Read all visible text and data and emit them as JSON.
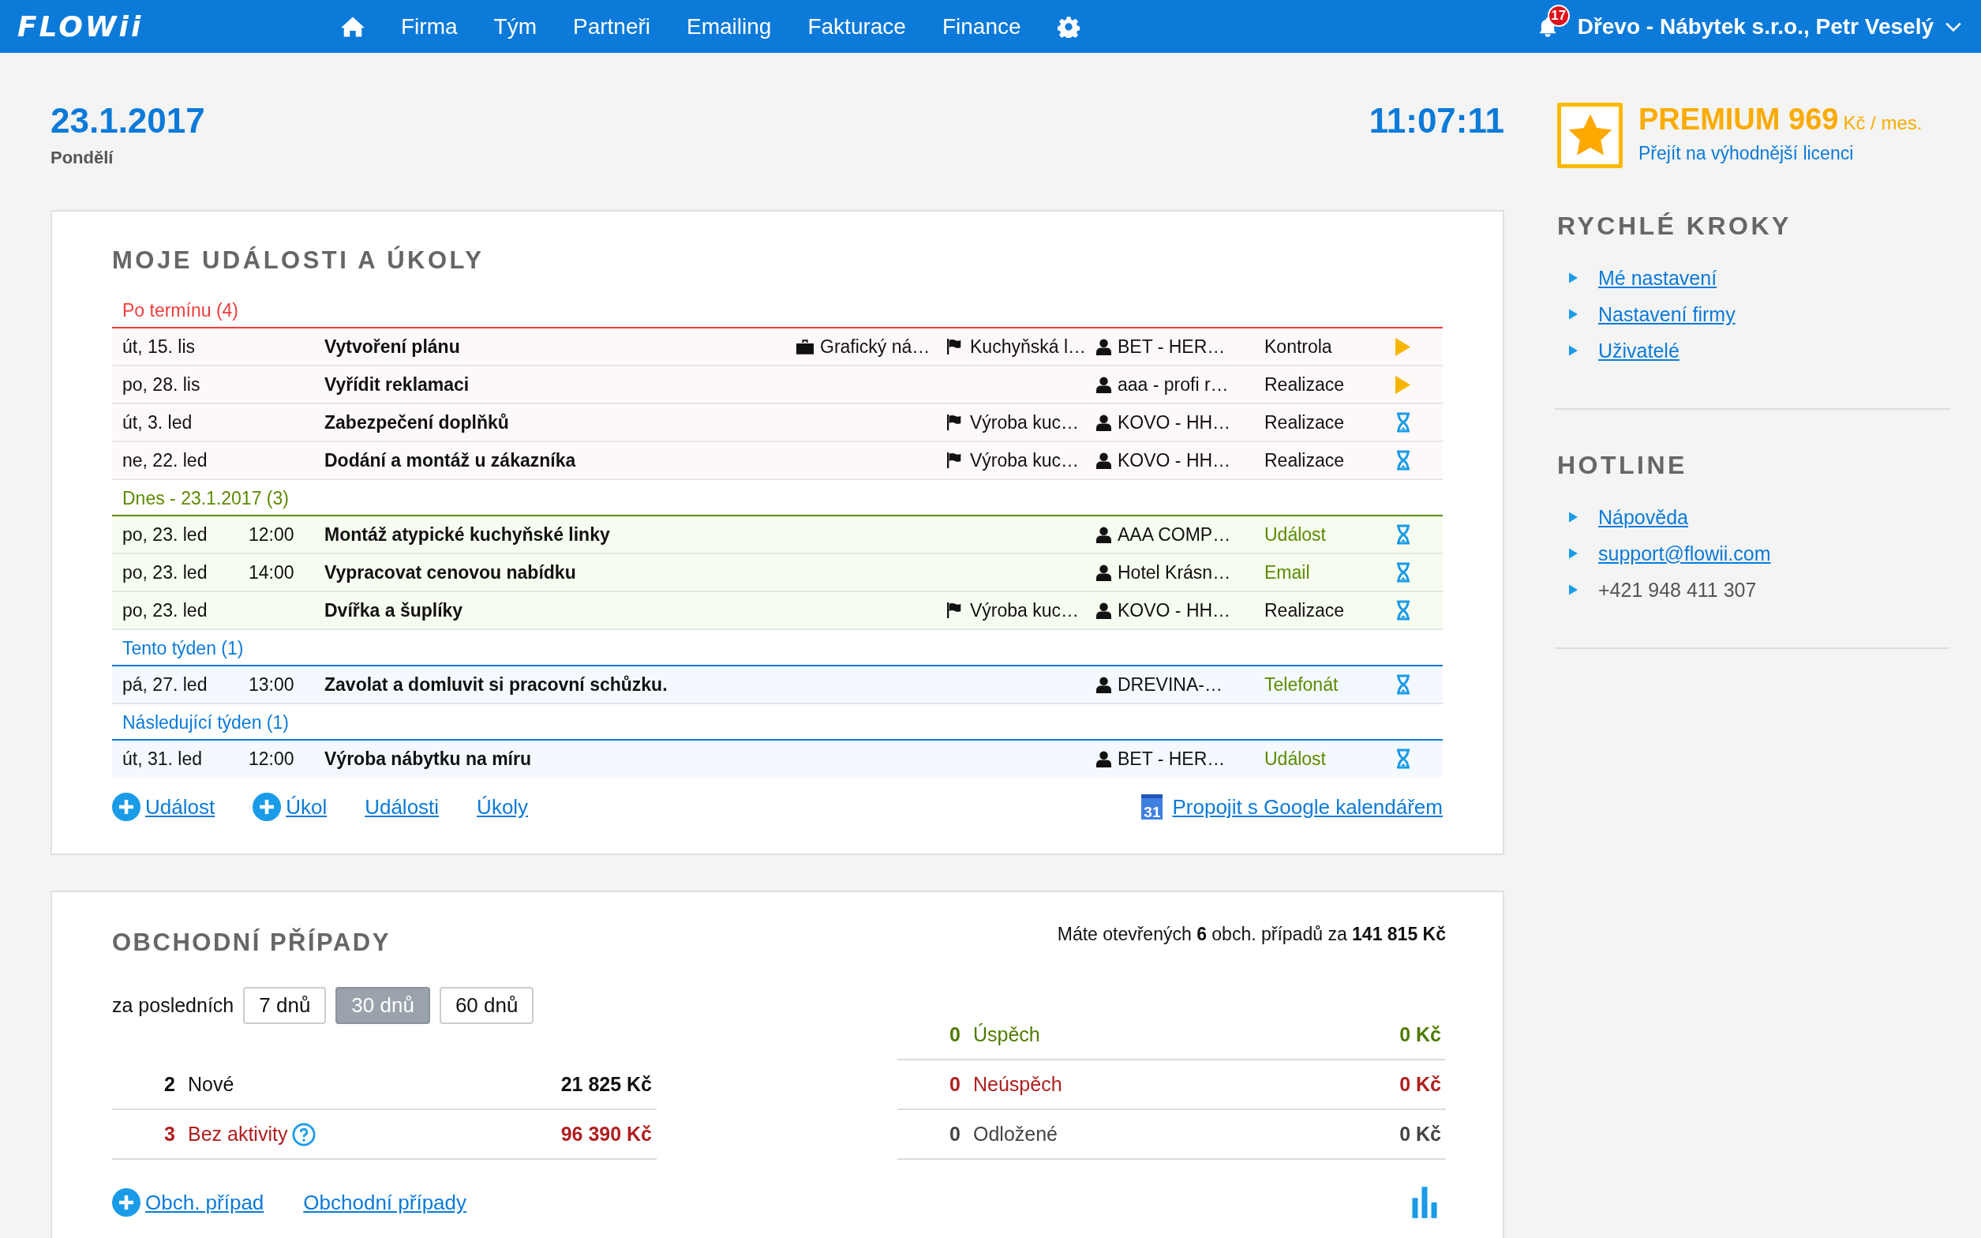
{
  "nav": {
    "logo": "FLOWii",
    "items": [
      "Firma",
      "Tým",
      "Partneři",
      "Emailing",
      "Fakturace",
      "Finance"
    ],
    "notifications": "17",
    "account": "Dřevo - Nábytek s.r.o., Petr Veselý"
  },
  "date": "23.1.2017",
  "weekday": "Pondělí",
  "time": "11:07:11",
  "events": {
    "title": "MOJE UDÁLOSTI A ÚKOLY",
    "groups": [
      {
        "label": "Po termínu (4)",
        "kind": "overdue",
        "rows": [
          {
            "date": "út, 15. lis",
            "title": "Vytvoření plánu",
            "project": "Grafický ná…",
            "deal": "Kuchyňská l…",
            "contact": "BET - HER…",
            "type": "Kontrola",
            "activity": false,
            "started": true
          },
          {
            "date": "po, 28. lis",
            "title": "Vyřídit reklamaci",
            "contact": "aaa - profi r…",
            "type": "Realizace",
            "activity": false,
            "started": true
          },
          {
            "date": "út, 3. led",
            "title": "Zabezpečení doplňků",
            "deal": "Výroba kuc…",
            "contact": "KOVO - HH…",
            "type": "Realizace",
            "activity": false,
            "started": false
          },
          {
            "date": "ne, 22. led",
            "title": "Dodání a montáž u zákazníka",
            "deal": "Výroba kuc…",
            "contact": "KOVO - HH…",
            "type": "Realizace",
            "activity": false,
            "started": false
          }
        ]
      },
      {
        "label": "Dnes - 23.1.2017 (3)",
        "kind": "today",
        "rows": [
          {
            "date": "po, 23. led",
            "time": "12:00",
            "title": "Montáž atypické kuchyňské linky",
            "contact": "AAA COMP…",
            "type": "Událost",
            "activity": true,
            "started": false
          },
          {
            "date": "po, 23. led",
            "time": "14:00",
            "title": "Vypracovat cenovou nabídku",
            "contact": "Hotel Krásn…",
            "type": "Email",
            "activity": true,
            "started": false
          },
          {
            "date": "po, 23. led",
            "title": "Dvířka a šuplíky",
            "deal": "Výroba kuc…",
            "contact": "KOVO - HH…",
            "type": "Realizace",
            "activity": false,
            "started": false
          }
        ]
      },
      {
        "label": "Tento týden (1)",
        "kind": "week",
        "rows": [
          {
            "date": "pá, 27. led",
            "time": "13:00",
            "title": "Zavolat a domluvit si pracovní schůzku.",
            "contact": "DREVINA-…",
            "type": "Telefonát",
            "activity": true,
            "started": false
          }
        ]
      },
      {
        "label": "Následující týden (1)",
        "kind": "week",
        "rows": [
          {
            "date": "út, 31. led",
            "time": "12:00",
            "title": "Výroba nábytku na míru",
            "contact": "BET - HER…",
            "type": "Událost",
            "activity": true,
            "started": false
          }
        ]
      }
    ],
    "links": [
      {
        "text": "Událost",
        "add": true
      },
      {
        "text": "Úkol",
        "add": true
      },
      {
        "text": "Události",
        "add": false
      },
      {
        "text": "Úkoly",
        "add": false
      }
    ],
    "calendar_day": "31",
    "google_link": "Propojit s Google kalendářem"
  },
  "deals": {
    "title": "OBCHODNÍ PŘÍPADY",
    "summary": "Máte otevřených **6** obch. případů za **141 815 Kč**",
    "period_label": "za posledních",
    "periods": [
      {
        "label": "7 dnů",
        "selected": false
      },
      {
        "label": "30 dnů",
        "selected": true
      },
      {
        "label": "60 dnů",
        "selected": false
      }
    ],
    "open": [
      {
        "count": "2",
        "label": "Nové",
        "amount": "21 825 Kč",
        "kind": "neutral",
        "help": false
      },
      {
        "count": "3",
        "label": "Bez aktivity",
        "amount": "96 390 Kč",
        "kind": "negative",
        "help": true
      }
    ],
    "closed": [
      {
        "count": "0",
        "label": "Úspěch",
        "amount": "0 Kč",
        "kind": "positive"
      },
      {
        "count": "0",
        "label": "Neúspěch",
        "amount": "0 Kč",
        "kind": "negative"
      },
      {
        "count": "0",
        "label": "Odložené",
        "amount": "0 Kč",
        "kind": "muted"
      }
    ],
    "links": [
      {
        "text": "Obch. případ",
        "add": true
      },
      {
        "text": "Obchodní případy",
        "add": false
      }
    ]
  },
  "premium": {
    "plan": "PREMIUM 969",
    "unit": "Kč / mes.",
    "link": "Přejít na výhodnější licenci"
  },
  "sidebar": [
    {
      "title": "RYCHLÉ KROKY",
      "items": [
        {
          "text": "Mé nastavení",
          "link": true
        },
        {
          "text": "Nastavení firmy",
          "link": true
        },
        {
          "text": "Uživatelé",
          "link": true
        }
      ]
    },
    {
      "title": "HOTLINE",
      "items": [
        {
          "text": "Nápověda",
          "link": true
        },
        {
          "text": "support@flowii.com",
          "link": true
        },
        {
          "text": "+421 948 411 307",
          "link": false
        }
      ]
    }
  ]
}
